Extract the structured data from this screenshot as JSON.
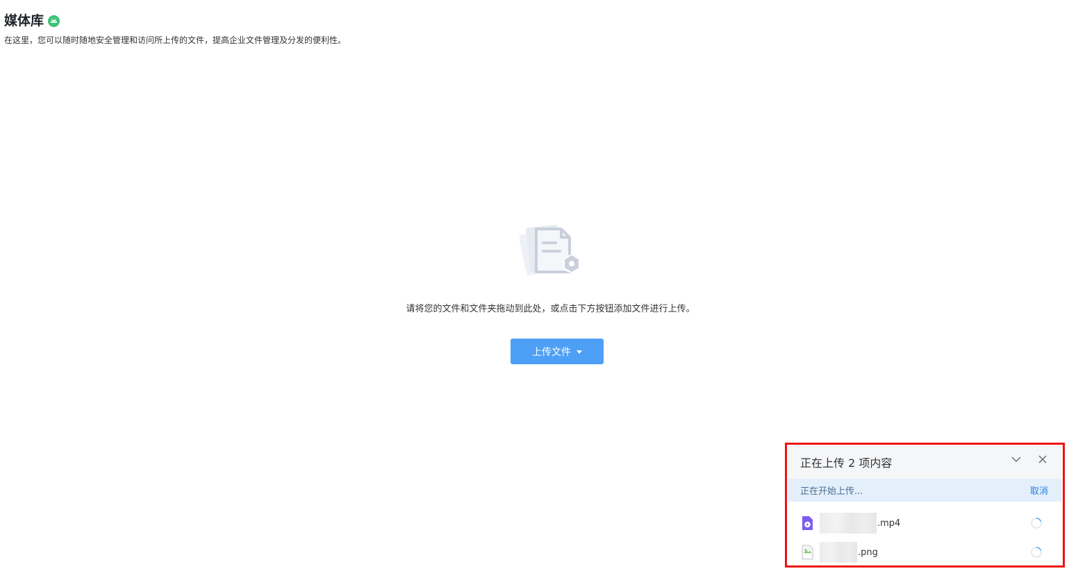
{
  "header": {
    "title": "媒体库",
    "subtitle": "在这里，您可以随时随地安全管理和访问所上传的文件，提高企业文件管理及分发的便利性。",
    "badge_icon": "android-icon"
  },
  "empty_state": {
    "illustration_icon": "document-settings-icon",
    "hint": "请将您的文件和文件夹拖动到此处，或点击下方按钮添加文件进行上传。",
    "upload_button_label": "上传文件"
  },
  "upload_panel": {
    "title": "正在上传 2 项内容",
    "status_text": "正在开始上传...",
    "cancel_label": "取消",
    "files": [
      {
        "name_suffix": ".mp4",
        "type_icon": "video-file-icon"
      },
      {
        "name_suffix": ".png",
        "type_icon": "png-file-icon"
      }
    ]
  },
  "colors": {
    "primary_button": "#4e9ff6",
    "highlight_border": "#ee1111",
    "status_bg": "#e3effb",
    "android_badge": "#3ec17a",
    "video_icon": "#7b5cf0"
  }
}
